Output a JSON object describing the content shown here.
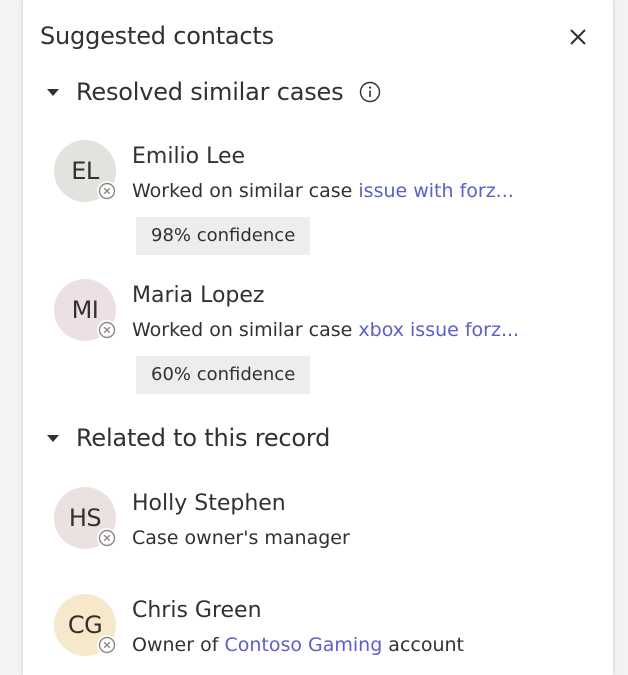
{
  "panel": {
    "title": "Suggested contacts",
    "close_icon": "close-icon"
  },
  "sections": [
    {
      "label": "Resolved similar cases",
      "icon": "info-icon",
      "contacts": [
        {
          "initials": "EL",
          "name": "Emilio Lee",
          "desc_prefix": "Worked on similar case ",
          "link": "issue with forz...",
          "desc_suffix": "",
          "confidence": "98% confidence",
          "avatar_color": "#e1e3df"
        },
        {
          "initials": "MI",
          "name": "Maria Lopez",
          "desc_prefix": "Worked on similar case ",
          "link": "xbox issue forz...",
          "desc_suffix": "",
          "confidence": "60% confidence",
          "avatar_color": "#ecdfe6"
        }
      ]
    },
    {
      "label": "Related to this record",
      "contacts": [
        {
          "initials": "HS",
          "name": "Holly Stephen",
          "desc_prefix": "Case owner's manager",
          "link": "",
          "desc_suffix": "",
          "avatar_color": "#ebe1e1"
        },
        {
          "initials": "CG",
          "name": "Chris Green",
          "desc_prefix": "Owner of ",
          "link": "Contoso Gaming",
          "desc_suffix": " account",
          "avatar_color": "#f6e8cb"
        }
      ]
    }
  ],
  "colors": {
    "text": "#323130",
    "link": "#5b5fc7",
    "badge_bg": "#ededed",
    "presence_icon": "#8a8886"
  }
}
